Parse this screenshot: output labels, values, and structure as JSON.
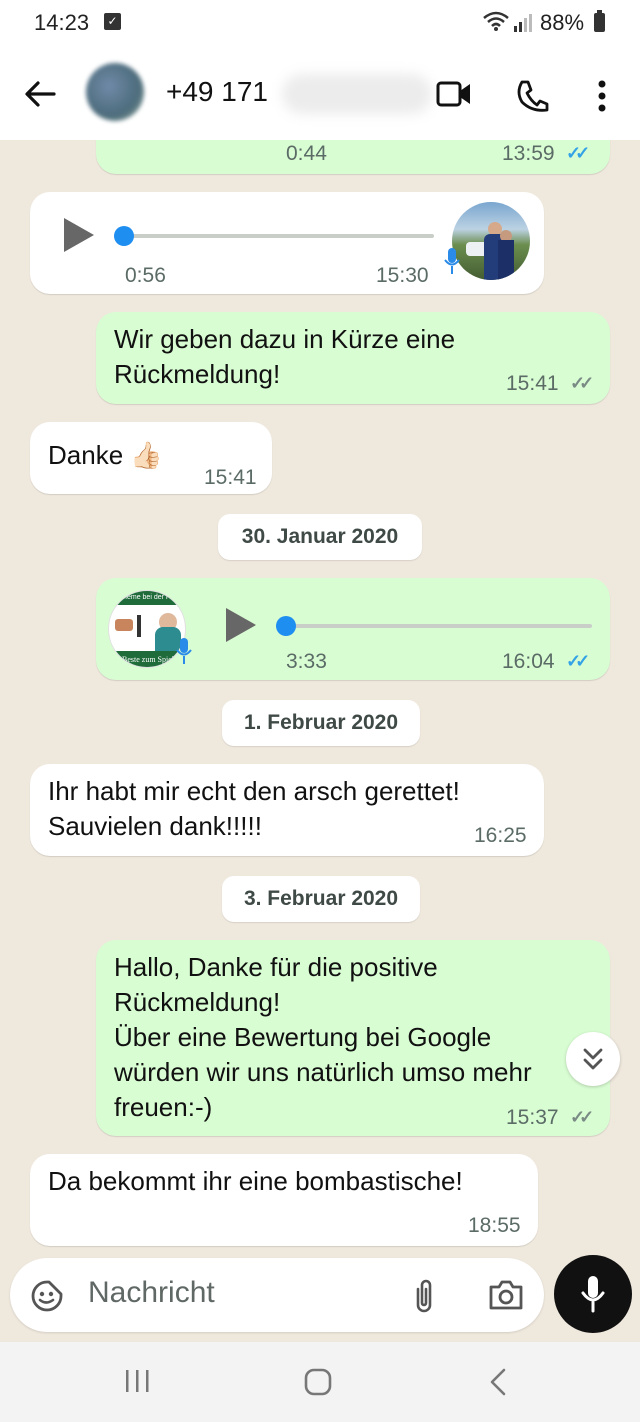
{
  "status_bar": {
    "time": "14:23",
    "battery": "88%"
  },
  "header": {
    "contact_name": "+49 171"
  },
  "messages": [
    {
      "duration": "0:44",
      "time": "13:59"
    },
    {
      "duration": "0:56",
      "time": "15:30"
    },
    {
      "text": "Wir geben dazu in Kürze eine Rückmeldung!",
      "time": "15:41"
    },
    {
      "text": "Danke 👍🏻",
      "time": "15:41"
    },
    {
      "duration": "3:33",
      "time": "16:04"
    },
    {
      "text": "Ihr habt mir echt den arsch gerettet!\nSauvielen dank!!!!!",
      "time": "16:25"
    },
    {
      "text": "Hallo, Danke für die positive Rückmeldung!\nÜber eine Bewertung bei Google würden wir uns natürlich umso mehr freuen:-)",
      "time": "15:37"
    },
    {
      "text": "Da bekommt ihr eine bombastische!",
      "time": "18:55"
    }
  ],
  "dates": [
    "30. Januar 2020",
    "1. Februar 2020",
    "3. Februar 2020"
  ],
  "thumb_text": {
    "bar": "Beste zum Spiel",
    "top": "rleme bei der Pr"
  },
  "input": {
    "placeholder": "Nachricht"
  },
  "icons": {
    "back": "arrow-left-icon",
    "video": "video-call-icon",
    "call": "phone-icon",
    "menu": "more-vertical-icon",
    "emoji": "sticker-icon",
    "attach": "paperclip-icon",
    "camera": "camera-icon",
    "mic": "microphone-icon",
    "scroll": "double-chevron-down-icon"
  },
  "colors": {
    "outgoing": "#d9fdd3",
    "incoming": "#ffffff",
    "read_tick": "#34a3e6",
    "wallpaper": "#efe8dd"
  }
}
